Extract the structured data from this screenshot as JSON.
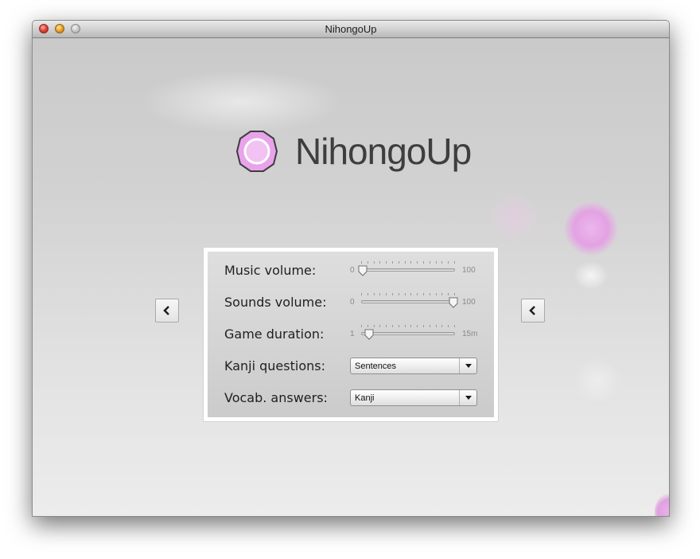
{
  "window": {
    "title": "NihongoUp"
  },
  "app": {
    "name": "NihongoUp",
    "logo_icon": "octagon-ring-logo-icon",
    "logo_color": "#e9a3ea"
  },
  "nav": {
    "prev_icon": "chevron-left-icon",
    "next_icon": "chevron-left-icon"
  },
  "settings": {
    "music_volume": {
      "label": "Music volume:",
      "min_label": "0",
      "max_label": "100",
      "value": 0,
      "min": 0,
      "max": 100
    },
    "sounds_volume": {
      "label": "Sounds volume:",
      "min_label": "0",
      "max_label": "100",
      "value": 100,
      "min": 0,
      "max": 100
    },
    "game_duration": {
      "label": "Game duration:",
      "min_label": "1",
      "max_label": "15m",
      "value": 2,
      "min": 1,
      "max": 15
    },
    "kanji_questions": {
      "label": "Kanji questions:",
      "selected": "Sentences"
    },
    "vocab_answers": {
      "label": "Vocab. answers:",
      "selected": "Kanji"
    }
  }
}
